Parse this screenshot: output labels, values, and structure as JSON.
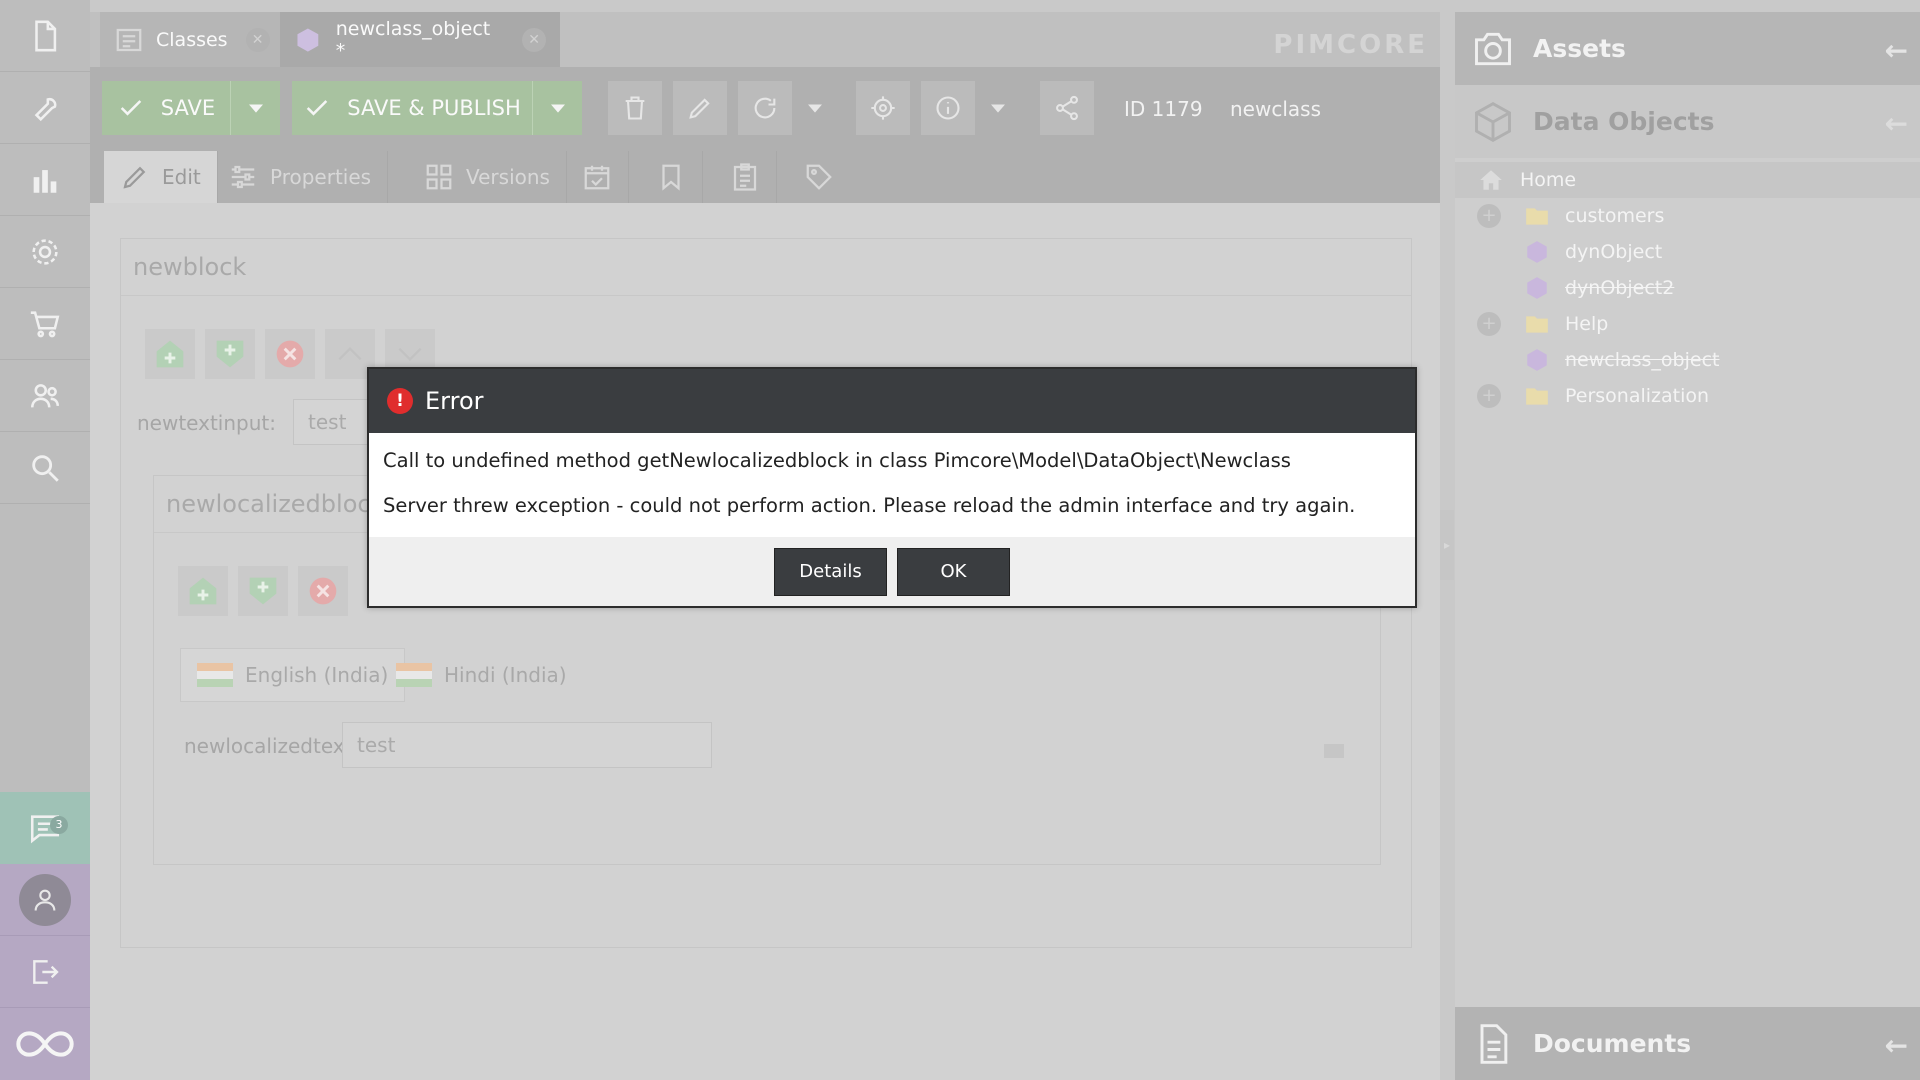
{
  "tabs": {
    "classes_label": "Classes",
    "object_label": "newclass_object *"
  },
  "brand": "PIMCORE",
  "toolbar": {
    "save_label": "SAVE",
    "save_publish_label": "SAVE & PUBLISH",
    "id_text": "ID 1179",
    "class_text": "newclass"
  },
  "subtabs": {
    "edit": "Edit",
    "properties": "Properties",
    "versions": "Versions"
  },
  "content": {
    "block_title": "newblock",
    "text_label": "newtextinput:",
    "text_value": "test",
    "loc_title": "newlocalizedblock",
    "lang_en": "English (India)",
    "lang_hi": "Hindi (India)",
    "loc_label": "newlocalizedtexti",
    "loc_value": "test"
  },
  "sidebar": {
    "notification_count": "3"
  },
  "right_panel": {
    "assets": "Assets",
    "data_objects": "Data Objects",
    "documents": "Documents",
    "tree": [
      "Home",
      "customers",
      "dynObject",
      "dynObject2",
      "Help",
      "newclass_object",
      "Personalization"
    ]
  },
  "dialog": {
    "title": "Error",
    "message": "Call to undefined method getNewlocalizedblock in class Pimcore\\Model\\DataObject\\Newclass",
    "detail": "Server threw exception - could not perform action. Please reload the admin interface and try again.",
    "details_button": "Details",
    "ok_button": "OK"
  }
}
